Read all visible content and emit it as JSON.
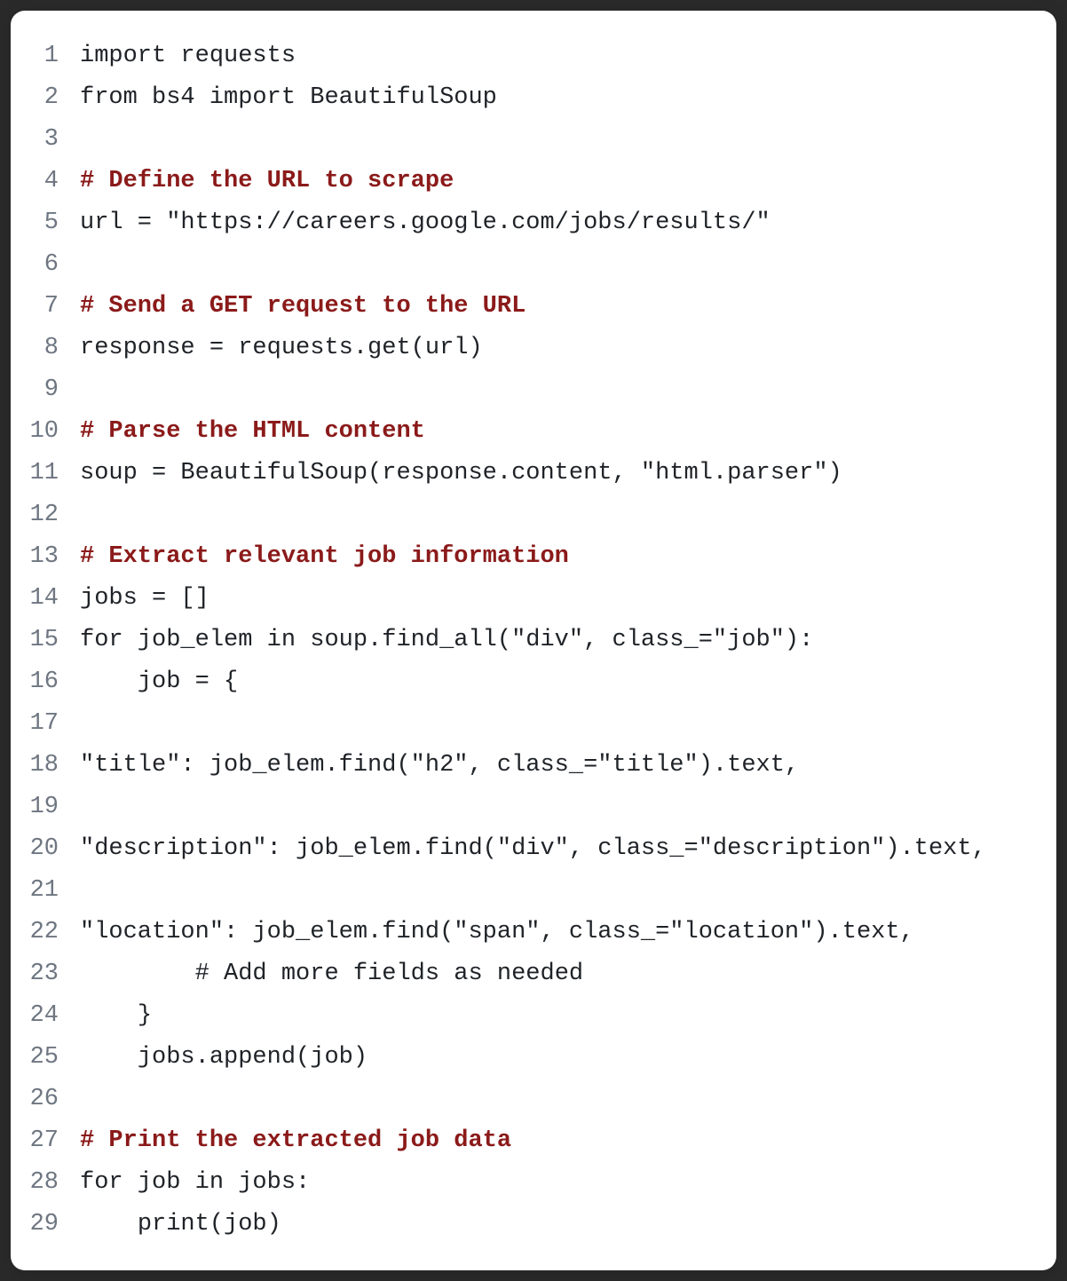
{
  "code": {
    "lines": [
      {
        "num": "1",
        "segments": [
          {
            "text": "import requests",
            "cls": ""
          }
        ]
      },
      {
        "num": "2",
        "segments": [
          {
            "text": "from bs4 import BeautifulSoup",
            "cls": ""
          }
        ]
      },
      {
        "num": "3",
        "segments": [
          {
            "text": "",
            "cls": ""
          }
        ]
      },
      {
        "num": "4",
        "segments": [
          {
            "text": "# Define the URL to scrape",
            "cls": "comment"
          }
        ]
      },
      {
        "num": "5",
        "segments": [
          {
            "text": "url = \"https://careers.google.com/jobs/results/\"",
            "cls": ""
          }
        ]
      },
      {
        "num": "6",
        "segments": [
          {
            "text": "",
            "cls": ""
          }
        ]
      },
      {
        "num": "7",
        "segments": [
          {
            "text": "# Send a GET request to the URL",
            "cls": "comment"
          }
        ]
      },
      {
        "num": "8",
        "segments": [
          {
            "text": "response = requests.get(url)",
            "cls": ""
          }
        ]
      },
      {
        "num": "9",
        "segments": [
          {
            "text": "",
            "cls": ""
          }
        ]
      },
      {
        "num": "10",
        "segments": [
          {
            "text": "# Parse the HTML content",
            "cls": "comment"
          }
        ]
      },
      {
        "num": "11",
        "segments": [
          {
            "text": "soup = BeautifulSoup(response.content, \"html.parser\")",
            "cls": ""
          }
        ]
      },
      {
        "num": "12",
        "segments": [
          {
            "text": "",
            "cls": ""
          }
        ]
      },
      {
        "num": "13",
        "segments": [
          {
            "text": "# Extract relevant job information",
            "cls": "comment"
          }
        ]
      },
      {
        "num": "14",
        "segments": [
          {
            "text": "jobs = []",
            "cls": ""
          }
        ]
      },
      {
        "num": "15",
        "segments": [
          {
            "text": "for job_elem in soup.find_all(\"div\", class_=\"job\"):",
            "cls": ""
          }
        ]
      },
      {
        "num": "16",
        "segments": [
          {
            "text": "    job = {",
            "cls": ""
          }
        ]
      },
      {
        "num": "17",
        "segments": [
          {
            "text": "",
            "cls": ""
          }
        ]
      },
      {
        "num": "18",
        "segments": [
          {
            "text": "\"title\": job_elem.find(\"h2\", class_=\"title\").text,",
            "cls": ""
          }
        ]
      },
      {
        "num": "19",
        "segments": [
          {
            "text": "",
            "cls": ""
          }
        ]
      },
      {
        "num": "20",
        "segments": [
          {
            "text": "\"description\": job_elem.find(\"div\", class_=\"description\").text,",
            "cls": ""
          }
        ]
      },
      {
        "num": "21",
        "segments": [
          {
            "text": "",
            "cls": ""
          }
        ]
      },
      {
        "num": "22",
        "segments": [
          {
            "text": "\"location\": job_elem.find(\"span\", class_=\"location\").text,",
            "cls": ""
          }
        ]
      },
      {
        "num": "23",
        "segments": [
          {
            "text": "        # Add more fields as needed",
            "cls": "comment-plain"
          }
        ]
      },
      {
        "num": "24",
        "segments": [
          {
            "text": "    }",
            "cls": ""
          }
        ]
      },
      {
        "num": "25",
        "segments": [
          {
            "text": "    jobs.append(job)",
            "cls": ""
          }
        ]
      },
      {
        "num": "26",
        "segments": [
          {
            "text": "",
            "cls": ""
          }
        ]
      },
      {
        "num": "27",
        "segments": [
          {
            "text": "# Print the extracted job data",
            "cls": "comment"
          }
        ]
      },
      {
        "num": "28",
        "segments": [
          {
            "text": "for job in jobs:",
            "cls": ""
          }
        ]
      },
      {
        "num": "29",
        "segments": [
          {
            "text": "    print(job)",
            "cls": ""
          }
        ]
      }
    ]
  }
}
